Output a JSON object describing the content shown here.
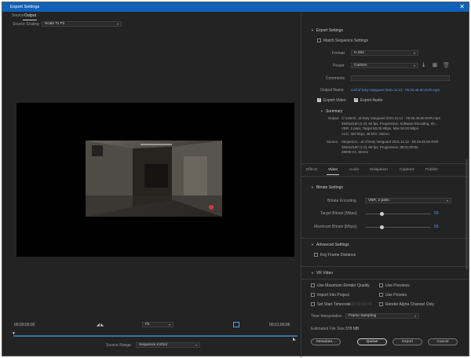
{
  "window": {
    "title": "Export Settings",
    "close": "✕"
  },
  "left": {
    "tabs": [
      "Source",
      "Output"
    ],
    "source_scaling_label": "Source Scaling",
    "source_scaling_value": "Scale To Fit",
    "timecode_start": "00;00;00;00",
    "timecode_end": "00;01;00;06",
    "fit_value": "Fit",
    "source_range_label": "Source Range",
    "source_range_value": "Sequence In/Out"
  },
  "export_settings": {
    "header": "Export Settings",
    "match_sequence": "Match Sequence Settings",
    "format_label": "Format",
    "format_value": "H.264",
    "preset_label": "Preset",
    "preset_value": "Custom",
    "comments_label": "Comments",
    "comments_value": "",
    "output_name_label": "Output Name",
    "output_name_value": "Call of Duty Vanguard 2021.11.12 - 06.35.45.50.DVR.mp4",
    "export_video": "Export Video",
    "export_audio": "Export Audio",
    "summary_header": "Summary",
    "output_label": "Output:",
    "output_lines": [
      "C:\\Users\\...al Duty  Vanguard 2021.11.12 - 06.35.45.50.DVR.mp4",
      "3840x2160 (1.0), 60 fps, Progressive, Software Encoding, 00...",
      "VBR, 2 pass, Target 50.00 Mbps, Max 50.00 Mbps",
      "AAC, 320 kbps, 48 kHz, Stereo"
    ],
    "source_label": "Source:",
    "source_lines": [
      "Sequence,...al of Duty  Vanguard 2021.11.12 - 06.35.45.50.DVR",
      "3840x2160 (1.0), 60 fps, Progressive, 00;01;00;06",
      "48000 Hz, Stereo"
    ]
  },
  "tabs": [
    "Effects",
    "Video",
    "Audio",
    "Multiplexer",
    "Captions",
    "Publish"
  ],
  "bitrate": {
    "header": "Bitrate Settings",
    "encoding_label": "Bitrate Encoding",
    "encoding_value": "VBR, 2 pass",
    "target_label": "Target Bitrate [Mbps]:",
    "target_value": "50",
    "max_label": "Maximum Bitrate [Mbps]:",
    "max_value": "50",
    "target_fraction": 0.25,
    "max_fraction": 0.25
  },
  "advanced": {
    "header": "Advanced Settings",
    "key_frame": "Key Frame Distance"
  },
  "vr": {
    "header": "VR Video"
  },
  "options": {
    "max_render_quality": "Use Maximum Render Quality",
    "use_previews": "Use Previews",
    "import_into_project": "Import Into Project",
    "use_proxies": "Use Proxies",
    "set_start_timecode": "Set Start Timecode",
    "start_timecode_value": "00;00;00;00",
    "render_alpha": "Render Alpha Channel Only",
    "time_interp_label": "Time Interpolation",
    "time_interp_value": "Frame Sampling",
    "file_size_label": "Estimated File Size:",
    "file_size_value": "378 MB"
  },
  "buttons": {
    "metadata": "Metadata...",
    "queue": "Queue",
    "export": "Export",
    "cancel": "Cancel"
  }
}
